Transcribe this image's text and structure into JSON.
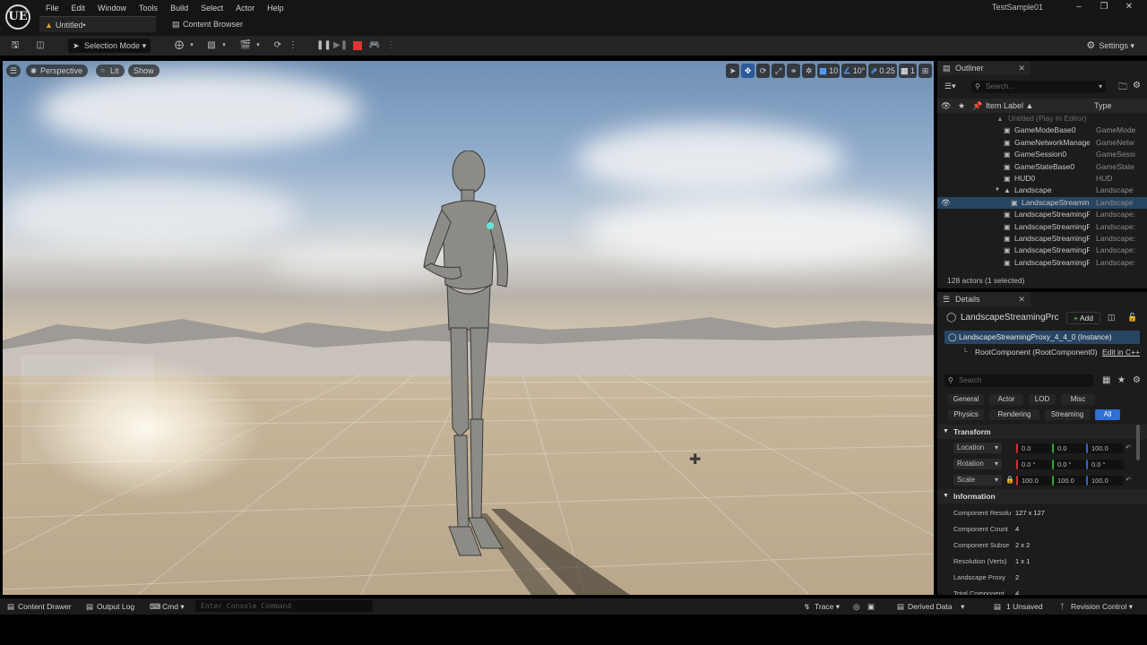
{
  "app": {
    "logo": "UE",
    "project": "TestSample01",
    "menu": [
      "File",
      "Edit",
      "Window",
      "Tools",
      "Build",
      "Select",
      "Actor",
      "Help"
    ],
    "window_controls": [
      "minimize-icon",
      "restore-icon",
      "close-icon"
    ],
    "tabs": [
      {
        "label": "Untitled•",
        "icon": "level-icon"
      },
      {
        "label": "Content Browser",
        "icon": "content-browser-icon"
      }
    ]
  },
  "toolbar": {
    "selection_mode": "Selection Mode",
    "settings": "Settings"
  },
  "viewport": {
    "perspective": "Perspective",
    "lit": "Lit",
    "show": "Show",
    "grid_snap": "10",
    "rotation_snap": "10°",
    "scale_snap": "0.25",
    "camera_speed": "1"
  },
  "outliner": {
    "title": "Outliner",
    "search_placeholder": "Search...",
    "col_label": "Item Label ▲",
    "col_type": "Type",
    "world_row": "Untitled (Play In Editor)",
    "rows": [
      {
        "label": "GameModeBase0",
        "type": "GameMode",
        "indent": 1
      },
      {
        "label": "GameNetworkManage",
        "type": "GameNetw",
        "indent": 1
      },
      {
        "label": "GameSession0",
        "type": "GameSessi",
        "indent": 1
      },
      {
        "label": "GameStateBase0",
        "type": "GameState",
        "indent": 1
      },
      {
        "label": "HUD0",
        "type": "HUD",
        "indent": 1
      },
      {
        "label": "Landscape",
        "type": "Landscape",
        "indent": 1,
        "expanded": true
      },
      {
        "label": "LandscapeStreamin",
        "type": "Landscape",
        "indent": 2,
        "selected": true
      },
      {
        "label": "LandscapeStreamingP",
        "type": "Landscape:",
        "indent": 1
      },
      {
        "label": "LandscapeStreamingP",
        "type": "Landscape:",
        "indent": 1
      },
      {
        "label": "LandscapeStreamingP",
        "type": "Landscape:",
        "indent": 1
      },
      {
        "label": "LandscapeStreamingP",
        "type": "Landscape:",
        "indent": 1
      },
      {
        "label": "LandscapeStreamingP",
        "type": "Landscape:",
        "indent": 1
      }
    ],
    "count": "128 actors (1 selected)"
  },
  "details": {
    "title": "Details",
    "actor_name": "LandscapeStreamingPrc",
    "add_label": "Add",
    "instance": "LandscapeStreamingProxy_4_4_0 (Instance)",
    "root_component": "RootComponent (RootComponent0)",
    "edit_cpp": "Edit in C++",
    "search_placeholder": "Search",
    "filters_row1": [
      "General",
      "Actor",
      "LOD",
      "Misc"
    ],
    "filters_row2": [
      "Physics",
      "Rendering",
      "Streaming",
      "All"
    ],
    "active_filter": "All",
    "transform_header": "Transform",
    "location": {
      "label": "Location",
      "x": "0.0",
      "y": "0.0",
      "z": "100.0"
    },
    "rotation": {
      "label": "Rotation",
      "x": "0.0 °",
      "y": "0.0 °",
      "z": "0.0 °"
    },
    "scale": {
      "label": "Scale",
      "x": "100.0",
      "y": "100.0",
      "z": "100.0"
    },
    "information_header": "Information",
    "info": [
      {
        "label": "Component Resolu",
        "value": "127 x 127"
      },
      {
        "label": "Component Count",
        "value": "4"
      },
      {
        "label": "Component Subse",
        "value": "2 x 2"
      },
      {
        "label": "Resolution (Verts)",
        "value": "1 x 1"
      },
      {
        "label": "Landscape Proxy",
        "value": "2"
      },
      {
        "label": "Total Component",
        "value": "4"
      }
    ]
  },
  "statusbar": {
    "content_drawer": "Content Drawer",
    "output_log": "Output Log",
    "cmd": "Cmd",
    "console_placeholder": "Enter Console Command",
    "trace": "Trace",
    "derived_data": "Derived Data",
    "unsaved": "1 Unsaved",
    "revision_control": "Revision Control"
  }
}
